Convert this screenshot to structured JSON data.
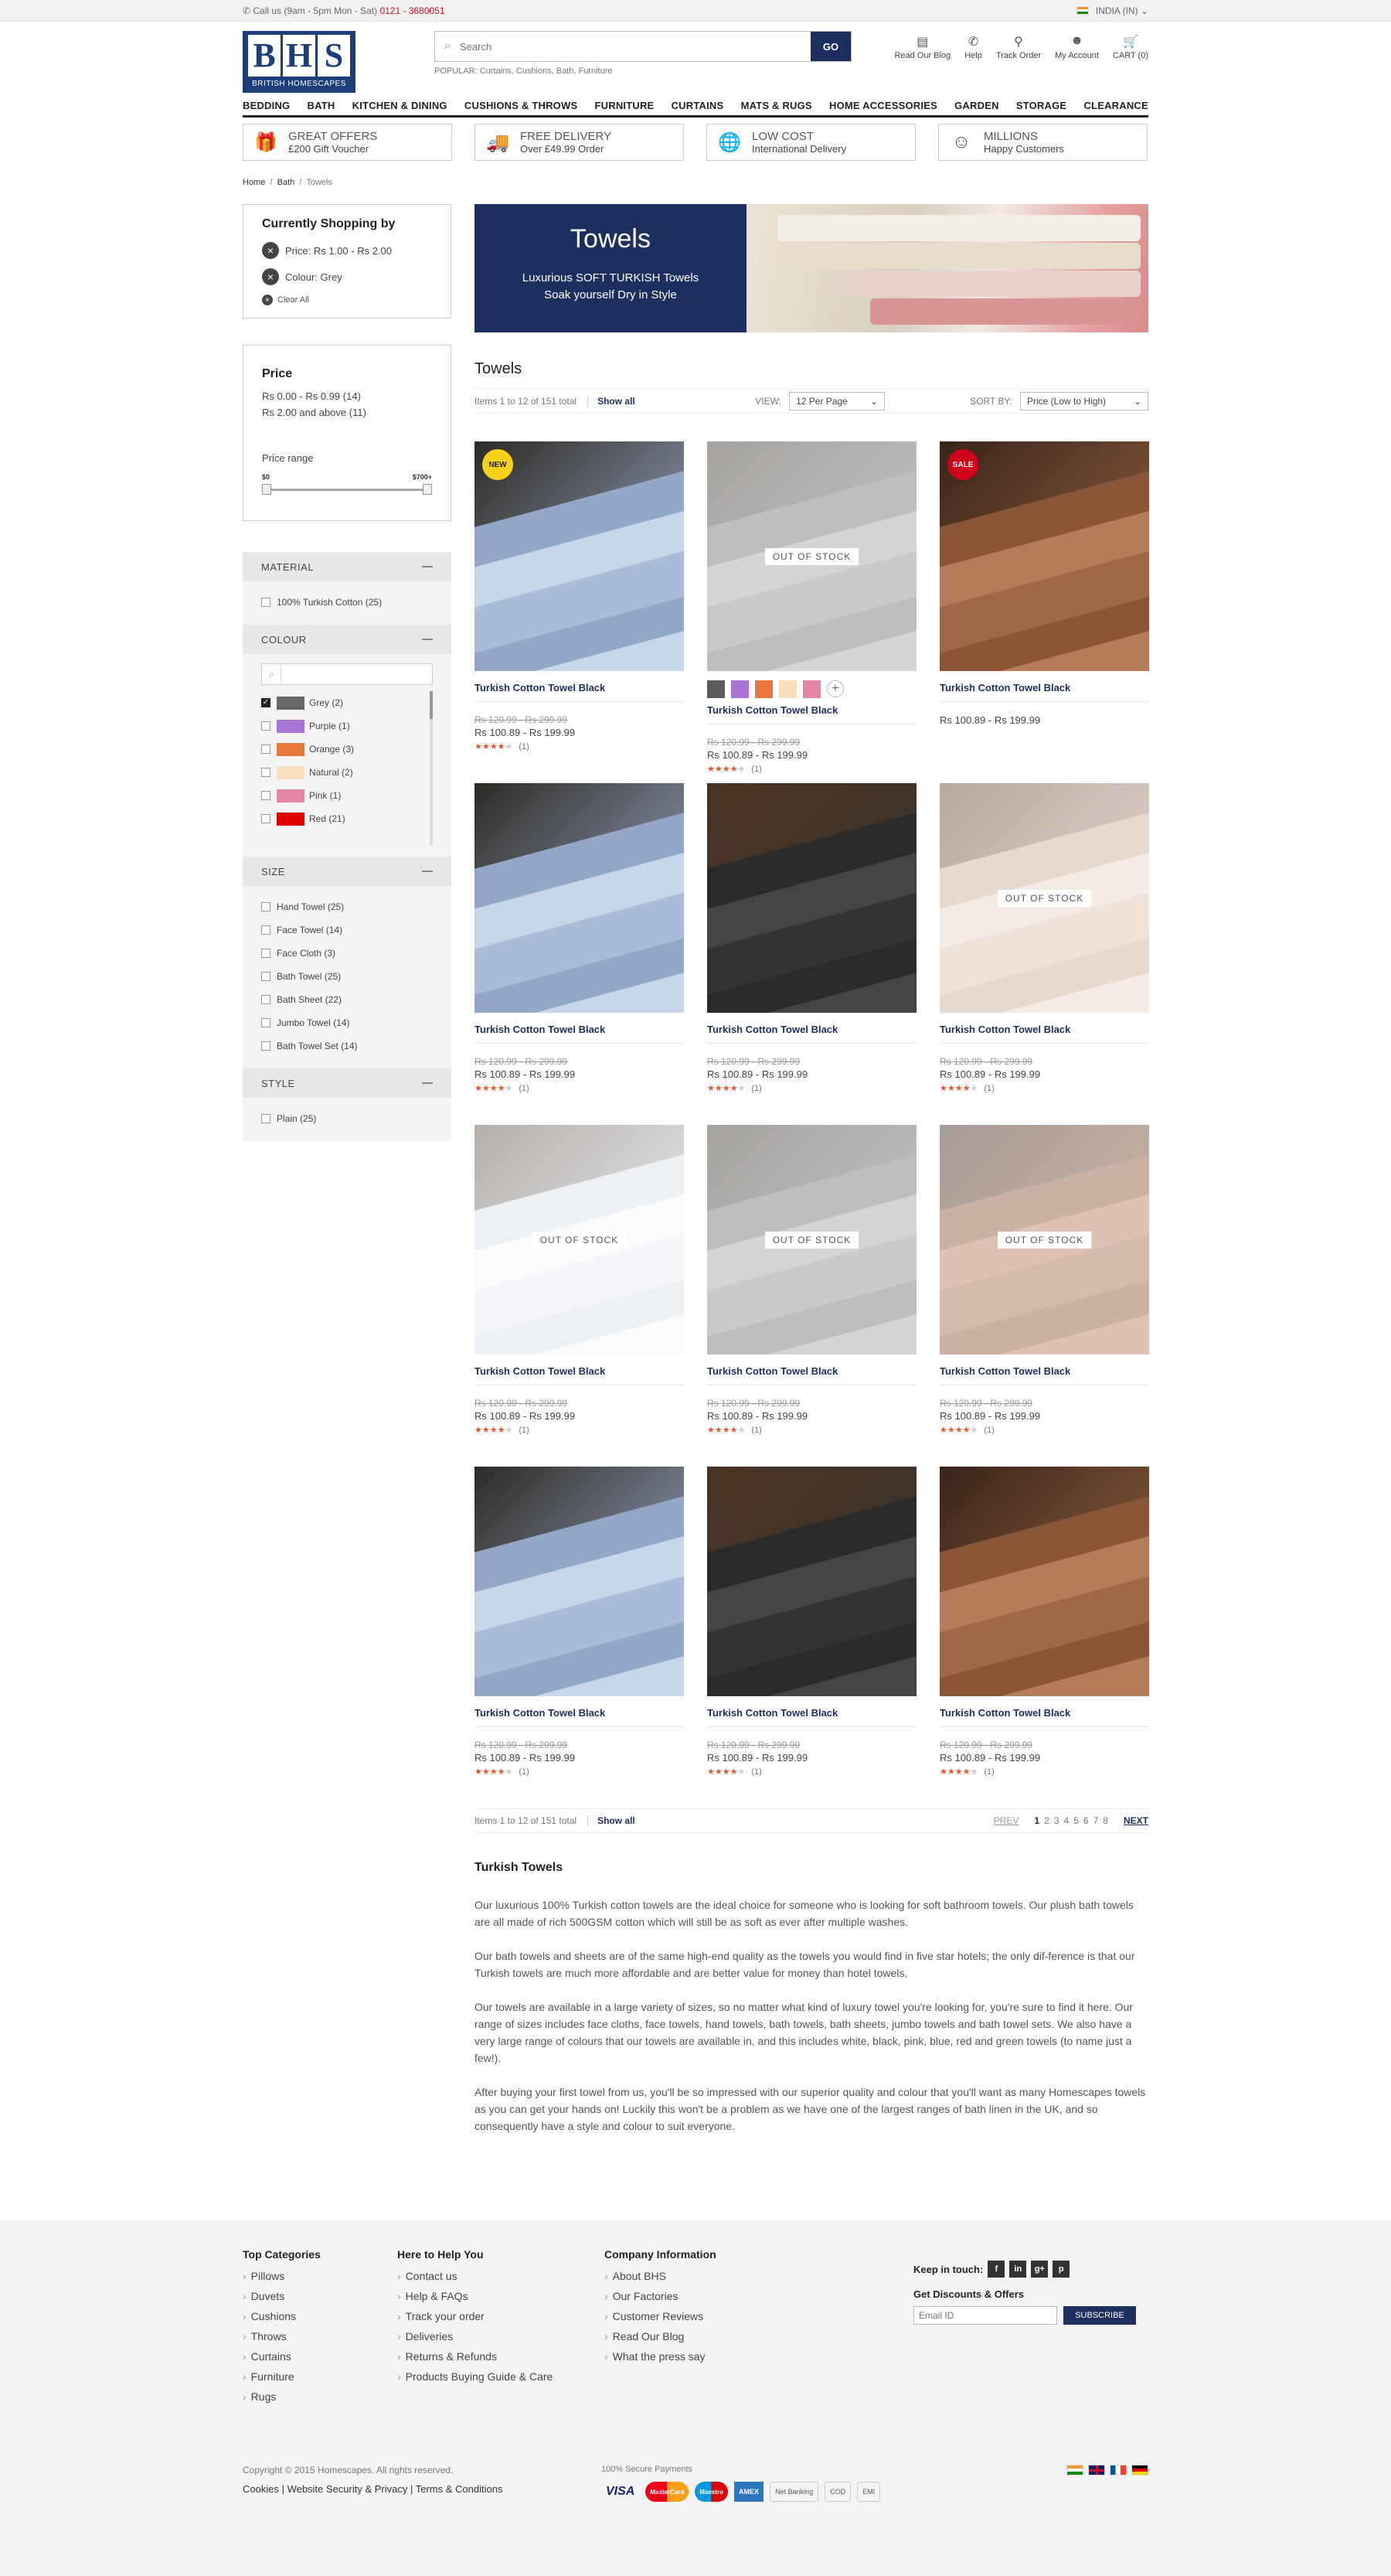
{
  "topbar": {
    "call_label": "Call us (9am - 5pm Mon - Sat)",
    "phone": "0121 - 3680051",
    "region": "INDIA (IN)"
  },
  "logo": {
    "letters": [
      "B",
      "H",
      "S"
    ],
    "tagline": "BRITISH HOMESCAPES"
  },
  "search": {
    "placeholder": "Search",
    "go_label": "GO",
    "popular": "POPULAR: Curtains, Cushions, Bath,  Furniture"
  },
  "header_links": [
    {
      "label": "Read Our Blog",
      "icon": "blog-icon"
    },
    {
      "label": "Help",
      "icon": "phone-icon"
    },
    {
      "label": "Track Order",
      "icon": "location-pin-icon"
    },
    {
      "label": "My Account",
      "icon": "user-icon"
    },
    {
      "label": "CART (0)",
      "icon": "cart-icon"
    }
  ],
  "nav": [
    "BEDDING",
    "BATH",
    "KITCHEN & DINING",
    "CUSHIONS & THROWS",
    "FURNITURE",
    "CURTAINS",
    "MATS & RUGS",
    "HOME ACCESSORIES",
    "GARDEN",
    "STORAGE",
    "CLEARANCE"
  ],
  "offers": [
    {
      "title": "GREAT OFFERS",
      "sub": "£200 Gift Voucher",
      "icon": "gift-icon"
    },
    {
      "title": "FREE DELIVERY",
      "sub": "Over £49.99 Order",
      "icon": "truck-icon"
    },
    {
      "title": "LOW COST",
      "sub": "International Delivery",
      "icon": "globe-icon"
    },
    {
      "title": "MILLIONS",
      "sub": "Happy Customers",
      "icon": "smiley-icon"
    }
  ],
  "breadcrumb": [
    "Home",
    "Bath",
    "Towels"
  ],
  "shopping_by": {
    "title": "Currently Shopping by",
    "filters": [
      "Price: Rs 1.00 - Rs 2.00",
      "Colour: Grey"
    ],
    "clear": "Clear All"
  },
  "price_filter": {
    "title": "Price",
    "options": [
      "Rs 0.00 - Rs 0.99 (14)",
      "Rs 2.00 and above (11)"
    ],
    "range_label": "Price range",
    "min": "$0",
    "max": "$700+"
  },
  "material": {
    "title": "MATERIAL",
    "items": [
      "100% Turkish Cotton (25)"
    ]
  },
  "colour": {
    "title": "COLOUR",
    "items": [
      {
        "label": "Grey (2)",
        "color": "#666666",
        "checked": true
      },
      {
        "label": "Purple (1)",
        "color": "#a974d6",
        "checked": false
      },
      {
        "label": "Orange (3)",
        "color": "#e9783d",
        "checked": false
      },
      {
        "label": "Natural (2)",
        "color": "#f8dfbd",
        "checked": false
      },
      {
        "label": "Pink (1)",
        "color": "#e487a4",
        "checked": false
      },
      {
        "label": "Red (21)",
        "color": "#e00000",
        "checked": false
      }
    ]
  },
  "size": {
    "title": "SIZE",
    "items": [
      "Hand Towel (25)",
      "Face Towel (14)",
      "Face Cloth (3)",
      "Bath Towel (25)",
      "Bath Sheet (22)",
      "Jumbo Towel (14)",
      "Bath Towel Set (14)"
    ]
  },
  "style": {
    "title": "STYLE",
    "items": [
      "Plain (25)"
    ]
  },
  "banner": {
    "title": "Towels",
    "line1": "Luxurious SOFT TURKISH Towels",
    "line2": "Soak yourself Dry in Style"
  },
  "listing": {
    "title": "Towels",
    "count_text": "Items 1 to 12 of 151 total",
    "show_all": "Show all",
    "view_label": "VIEW:",
    "view_value": "12 Per Page",
    "sort_label": "SORT BY:",
    "sort_value": "Price (Low to High)",
    "out_of_stock": "OUT OF STOCK",
    "products": [
      {
        "name": "Turkish Cotton Towel Black",
        "old": "Rs 120.99 - Rs 299.99",
        "price": "Rs 100.89 - Rs 199.99",
        "stars": 4,
        "reviews": "(1)",
        "badge": "NEW",
        "oos": false,
        "tone": "blue"
      },
      {
        "name": "Turkish Cotton Towel Black",
        "old": "Rs 120.99 - Rs 299.99",
        "price": "Rs 100.89 - Rs 199.99",
        "stars": 4,
        "reviews": "(1)",
        "badge": "",
        "oos": true,
        "tone": "grey",
        "swatches": [
          "#5b5b5b",
          "#a974d6",
          "#e9783d",
          "#f8dfbd",
          "#e487a4"
        ]
      },
      {
        "name": "Turkish Cotton Towel Black",
        "old": "",
        "price": "Rs 100.89 - Rs 199.99",
        "stars": 0,
        "reviews": "",
        "badge": "SALE",
        "oos": false,
        "tone": "brown"
      },
      {
        "name": "Turkish Cotton Towel Black",
        "old": "Rs 120.99 - Rs 299.99",
        "price": "Rs 100.89 - Rs 199.99",
        "stars": 4,
        "reviews": "(1)",
        "badge": "",
        "oos": false,
        "tone": "blue"
      },
      {
        "name": "Turkish Cotton Towel Black",
        "old": "Rs 120.99 - Rs 299.99",
        "price": "Rs 100.89 - Rs 199.99",
        "stars": 4,
        "reviews": "(1)",
        "badge": "",
        "oos": false,
        "tone": "black"
      },
      {
        "name": "Turkish Cotton Towel Black",
        "old": "Rs 120.99 - Rs 299.99",
        "price": "Rs 100.89 - Rs 199.99",
        "stars": 4,
        "reviews": "(1)",
        "badge": "",
        "oos": true,
        "tone": "beige"
      },
      {
        "name": "Turkish Cotton Towel Black",
        "old": "Rs 120.99 - Rs 299.99",
        "price": "Rs 100.89 - Rs 199.99",
        "stars": 4,
        "reviews": "(1)",
        "badge": "",
        "oos": true,
        "tone": "white"
      },
      {
        "name": "Turkish Cotton Towel Black",
        "old": "Rs 120.99 - Rs 299.99",
        "price": "Rs 100.89 - Rs 199.99",
        "stars": 4,
        "reviews": "(1)",
        "badge": "",
        "oos": true,
        "tone": "grey"
      },
      {
        "name": "Turkish Cotton Towel Black",
        "old": "Rs 120.99 - Rs 299.99",
        "price": "Rs 100.89 - Rs 199.99",
        "stars": 4,
        "reviews": "(1)",
        "badge": "",
        "oos": true,
        "tone": "brown"
      },
      {
        "name": "Turkish Cotton Towel Black",
        "old": "Rs 120.99 - Rs 299.99",
        "price": "Rs 100.89 - Rs 199.99",
        "stars": 4,
        "reviews": "(1)",
        "badge": "",
        "oos": false,
        "tone": "blue"
      },
      {
        "name": "Turkish Cotton Towel Black",
        "old": "Rs 120.99 - Rs 299.99",
        "price": "Rs 100.89 - Rs 199.99",
        "stars": 4,
        "reviews": "(1)",
        "badge": "",
        "oos": false,
        "tone": "black"
      },
      {
        "name": "Turkish Cotton Towel Black",
        "old": "Rs 120.99 - Rs 299.99",
        "price": "Rs 100.89 - Rs 199.99",
        "stars": 4,
        "reviews": "(1)",
        "badge": "",
        "oos": false,
        "tone": "brown"
      }
    ]
  },
  "pagination": {
    "prev": "PREV",
    "pages": [
      "1",
      "2",
      "3",
      "4",
      "5",
      "6",
      "7",
      "8"
    ],
    "current": "1",
    "next": "NEXT"
  },
  "seo": {
    "title": "Turkish Towels",
    "paragraphs": [
      "Our luxurious 100% Turkish cotton towels are the ideal choice for someone who is looking for soft bathroom towels. Our plush bath towels are all made of rich 500GSM cotton which will still be as soft as ever after multiple washes.",
      "Our bath towels and sheets are of the same high-end quality as the towels you would find in five star hotels; the only dif-ference is that our Turkish towels are much more affordable and are better value for money than hotel towels.",
      "Our towels are available in a large variety of sizes, so no matter what kind of luxury towel you're looking for, you're sure to find it here. Our range of sizes includes face cloths, face towels, hand towels, bath towels, bath sheets, jumbo towels and bath towel sets. We also have a very large range of colours that our towels are available in, and this includes white, black, pink, blue, red and green towels (to name just a few!).",
      "After buying your first towel from us, you'll be so impressed with our superior quality and colour that you'll want as many Homescapes towels as you can get your hands on! Luckily this won't be a problem as we have one of the largest ranges of bath linen in the UK, and so consequently have a style and colour to suit everyone."
    ]
  },
  "footer": {
    "top_categories": {
      "title": "Top Categories",
      "items": [
        "Pillows",
        "Duvets",
        "Cushions",
        "Throws",
        "Curtains",
        "Furniture",
        "Rugs"
      ]
    },
    "help": {
      "title": "Here to Help You",
      "items": [
        "Contact us",
        "Help & FAQs",
        "Track your order",
        "Deliveries",
        "Returns & Refunds",
        "Products Buying Guide & Care"
      ]
    },
    "company": {
      "title": "Company Information",
      "items": [
        "About BHS",
        "Our Factories",
        "Customer Reviews",
        "Read Our Blog",
        "What the press say"
      ]
    },
    "keep_in_touch": "Keep in touch:",
    "social": [
      "f",
      "in",
      "g+",
      "p"
    ],
    "discounts": "Get Discounts & Offers",
    "email_placeholder": "Email ID",
    "subscribe": "SUBSCRIBE",
    "copyright": "Copyright © 2015 Homescapes. All rights reserved.",
    "bottom_links": "Cookies  | Website Security & Privacy   |  Terms & Conditions",
    "secure_payments": "100% Secure Payments",
    "payment_methods": [
      "VISA",
      "MasterCard",
      "Maestro",
      "AMEX",
      "Net Banking",
      "COD",
      "EMI"
    ]
  }
}
